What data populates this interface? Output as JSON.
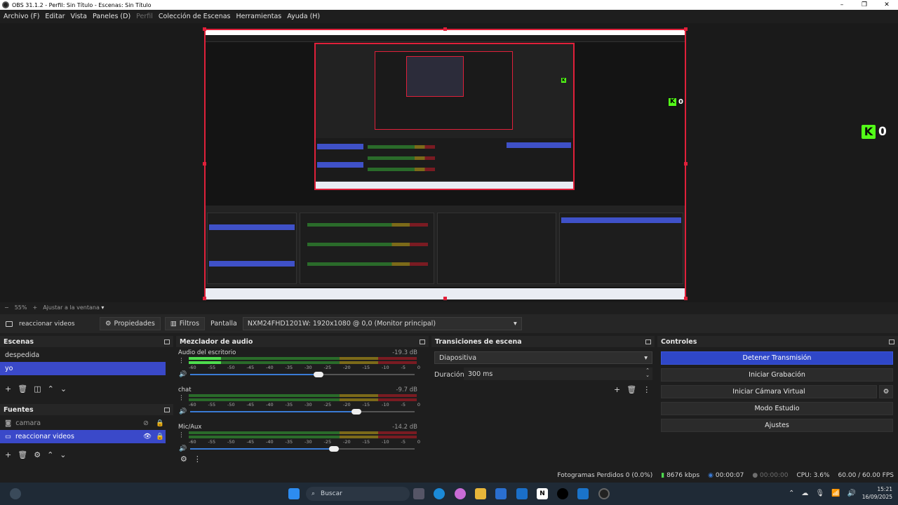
{
  "window": {
    "title": "OBS 31.1.2 - Perfil: Sin Título - Escenas: Sin Título",
    "controls": [
      "–",
      "❐",
      "✕"
    ]
  },
  "menu": [
    "Archivo (F)",
    "Editar",
    "Vista",
    "Paneles (D)",
    "Perfil",
    "Colección de Escenas",
    "Herramientas",
    "Ayuda (H)"
  ],
  "preview": {
    "kick_count": "0",
    "nested_kick_count": "0"
  },
  "zoom": {
    "minus": "−",
    "value": "55%",
    "plus": "+",
    "fit_label": "Ajustar a la ventana"
  },
  "source_toolbar": {
    "selected_source": "reaccionar videos",
    "properties_label": "Propiedades",
    "filters_label": "Filtros",
    "display_label": "Pantalla",
    "display_value": "NXM24FHD1201W: 1920x1080 @ 0,0 (Monitor principal)"
  },
  "scenes": {
    "header": "Escenas",
    "items": [
      {
        "label": "despedida",
        "selected": false
      },
      {
        "label": "yo",
        "selected": true
      }
    ]
  },
  "sources": {
    "header": "Fuentes",
    "items": [
      {
        "label": "camara",
        "visible": false,
        "locked": true
      },
      {
        "label": "reaccionar videos",
        "visible": true,
        "locked": true
      }
    ]
  },
  "mixer": {
    "header": "Mezclador de audio",
    "scale": [
      "-60",
      "-55",
      "-50",
      "-45",
      "-40",
      "-35",
      "-30",
      "-25",
      "-20",
      "-15",
      "-10",
      "-5",
      "0"
    ],
    "channels": [
      {
        "name": "Audio del escritorio",
        "db": "-19.3 dB",
        "level": 0.14,
        "volume": 0.55
      },
      {
        "name": "chat",
        "db": "-9.7 dB",
        "level": 0.0,
        "volume": 0.72
      },
      {
        "name": "Mic/Aux",
        "db": "-14.2 dB",
        "level": 0.0,
        "volume": 0.62
      }
    ]
  },
  "transitions": {
    "header": "Transiciones de escena",
    "type": "Diapositiva",
    "duration_label": "Duración",
    "duration_value": "300 ms"
  },
  "controls": {
    "header": "Controles",
    "buttons": [
      "Detener Transmisión",
      "Iniciar Grabación",
      "Iniciar Cámara Virtual",
      "Modo Estudio",
      "Ajustes"
    ]
  },
  "status": {
    "dropped_frames": "Fotogramas Perdidos 0 (0.0%)",
    "bitrate": "8676 kbps",
    "stream_time": "00:00:07",
    "rec_time": "00:00:00",
    "cpu": "CPU: 3.6%",
    "fps": "60.00 / 60.00 FPS"
  },
  "taskbar": {
    "search_placeholder": "Buscar",
    "time": "15:21",
    "date": "16/09/2025"
  },
  "colors": {
    "accent": "#3a49c9",
    "selection_border": "#e0203a",
    "kick_green": "#53fc18"
  }
}
